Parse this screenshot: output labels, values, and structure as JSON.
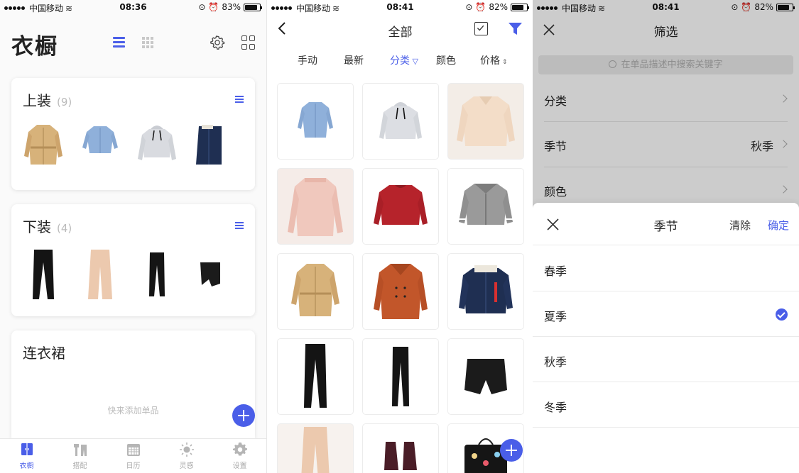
{
  "status_bars": [
    {
      "carrier": "中国移动",
      "time": "08:36",
      "battery": "83%",
      "battery_level": 0.83
    },
    {
      "carrier": "中国移动",
      "time": "08:41",
      "battery": "82%",
      "battery_level": 0.82
    },
    {
      "carrier": "中国移动",
      "time": "08:41",
      "battery": "82%",
      "battery_level": 0.82
    }
  ],
  "wardrobe": {
    "title": "衣橱",
    "view_mode": "list",
    "categories": [
      {
        "name": "上装",
        "count": "(9)",
        "items": [
          "tan-coat",
          "blue-shirt",
          "grey-hoodie",
          "denim-jacket"
        ]
      },
      {
        "name": "下装",
        "count": "(4)",
        "items": [
          "black-pants",
          "beige-pants",
          "black-slim-pants",
          "black-shorts"
        ]
      },
      {
        "name": "连衣裙",
        "count": "",
        "empty_hint": "快来添加单品"
      }
    ],
    "tabs": [
      {
        "label": "衣橱",
        "icon": "wardrobe-icon",
        "active": true
      },
      {
        "label": "搭配",
        "icon": "outfit-icon",
        "active": false
      },
      {
        "label": "日历",
        "icon": "calendar-icon",
        "active": false
      },
      {
        "label": "灵感",
        "icon": "inspiration-icon",
        "active": false
      },
      {
        "label": "设置",
        "icon": "settings-icon",
        "active": false
      }
    ]
  },
  "all_items": {
    "title": "全部",
    "sort_options": [
      {
        "label": "手动",
        "active": false
      },
      {
        "label": "最新",
        "active": false
      },
      {
        "label": "分类",
        "active": true
      },
      {
        "label": "颜色",
        "active": false
      },
      {
        "label": "价格",
        "active": false
      }
    ],
    "grid": [
      "blue-shirt",
      "grey-hoodie",
      "cream-sweater",
      "pink-sweater",
      "red-sweater",
      "plaid-jacket",
      "tan-coat",
      "orange-coat",
      "denim-jacket",
      "black-pants",
      "black-slim-pants",
      "black-shorts",
      "beige-pants",
      "burgundy-shoes",
      "black-bag"
    ]
  },
  "filter": {
    "title": "筛选",
    "search_placeholder": "在单品描述中搜索关键字",
    "rows": [
      {
        "label": "分类",
        "value": ""
      },
      {
        "label": "季节",
        "value": "秋季"
      },
      {
        "label": "颜色",
        "value": ""
      }
    ],
    "sheet": {
      "title": "季节",
      "clear_label": "清除",
      "confirm_label": "确定",
      "options": [
        {
          "label": "春季",
          "selected": false
        },
        {
          "label": "夏季",
          "selected": true
        },
        {
          "label": "秋季",
          "selected": false
        },
        {
          "label": "冬季",
          "selected": false
        }
      ]
    }
  },
  "colors": {
    "accent": "#4a5ee8",
    "muted": "#aaaaaa"
  }
}
